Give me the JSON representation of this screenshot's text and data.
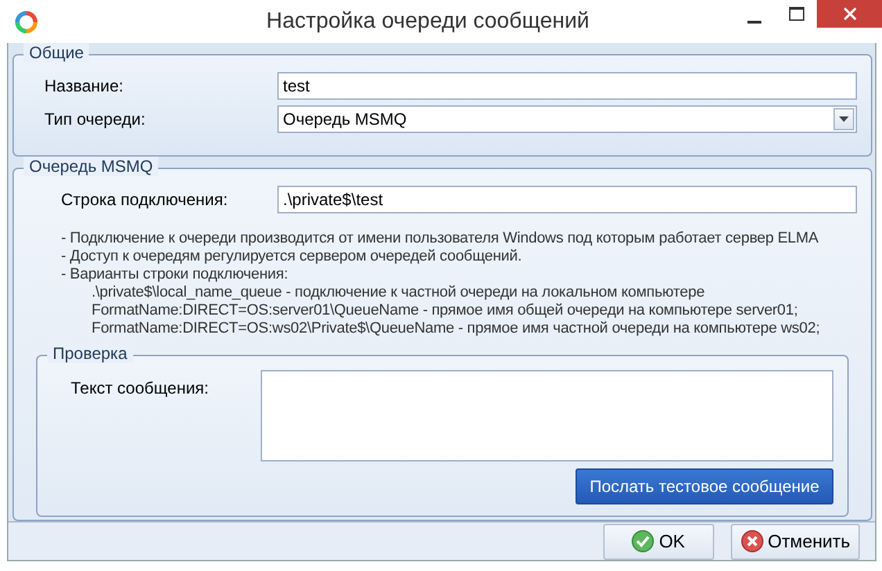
{
  "window": {
    "title": "Настройка очереди сообщений"
  },
  "general": {
    "legend": "Общие",
    "name_label": "Название:",
    "name_value": "test",
    "type_label": "Тип очереди:",
    "type_value": "Очередь MSMQ"
  },
  "msmq": {
    "legend": "Очередь MSMQ",
    "connection_label": "Строка подключения:",
    "connection_value": ".\\private$\\test",
    "notes": [
      {
        "kind": "bullet",
        "text": "- Подключение к очереди производится от имени пользователя Windows под которым работает сервер ELMA"
      },
      {
        "kind": "bullet",
        "text": "- Доступ к очередям регулируется сервером очередей сообщений."
      },
      {
        "kind": "bullet",
        "text": "- Варианты строки подключения:"
      },
      {
        "kind": "example",
        "text": ".\\private$\\local_name_queue - подключение к частной очереди на локальном компьютере"
      },
      {
        "kind": "example",
        "text": "FormatName:DIRECT=OS:server01\\QueueName - прямое имя общей очереди на компьютере server01;"
      },
      {
        "kind": "example",
        "text": "FormatName:DIRECT=OS:ws02\\Private$\\QueueName - прямое имя частной очереди на компьютере ws02;"
      }
    ]
  },
  "check": {
    "legend": "Проверка",
    "message_label": "Текст сообщения:",
    "send_button": "Послать тестовое сообщение"
  },
  "buttons": [
    {
      "kind": "ok",
      "label": "OK"
    },
    {
      "kind": "cancel",
      "label": "Отменить"
    }
  ]
}
